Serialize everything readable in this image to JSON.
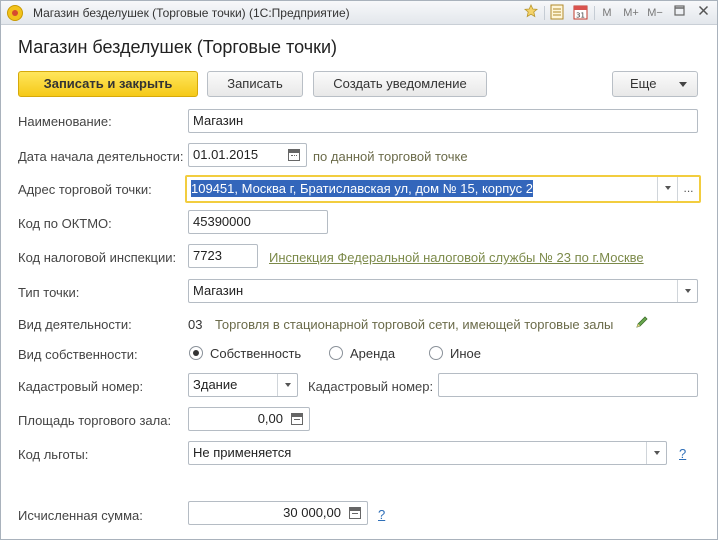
{
  "window": {
    "title": "Магазин безделушек (Торговые точки)  (1С:Предприятие)",
    "toolbar_icons": [
      "star-icon",
      "notes-icon",
      "calendar-icon"
    ],
    "memory_buttons": [
      "M",
      "M+",
      "M−"
    ]
  },
  "form": {
    "heading": "Магазин безделушек (Торговые точки)"
  },
  "toolbar": {
    "save_close_label": "Записать и закрыть",
    "save_label": "Записать",
    "notify_label": "Создать уведомление",
    "more_label": "Еще"
  },
  "fields": {
    "name": {
      "label": "Наименование:",
      "value": "Магазин"
    },
    "start_date": {
      "label": "Дата начала деятельности:",
      "value": "01.01.2015",
      "note": "по данной торговой точке"
    },
    "address": {
      "label": "Адрес торговой точки:",
      "value": "109451, Москва г, Братиславская ул, дом № 15, корпус 2",
      "more": "..."
    },
    "oktmo": {
      "label": "Код по ОКТМО:",
      "value": "45390000"
    },
    "tax_office": {
      "label": "Код налоговой инспекции:",
      "value": "7723",
      "link": "Инспекция Федеральной налоговой службы № 23 по г.Москве"
    },
    "point_type": {
      "label": "Тип точки:",
      "value": "Магазин"
    },
    "activity": {
      "label": "Вид деятельности:",
      "code": "03",
      "description": "Торговля в стационарной торговой сети, имеющей торговые залы"
    },
    "ownership": {
      "label": "Вид собственности:",
      "options": [
        "Собственность",
        "Аренда",
        "Иное"
      ],
      "selected": "Собственность"
    },
    "cadastral": {
      "label": "Кадастровый номер:",
      "type_value": "Здание",
      "number_label": "Кадастровый номер:",
      "number_value": ""
    },
    "hall_area": {
      "label": "Площадь торгового зала:",
      "value": "0,00"
    },
    "benefit_code": {
      "label": "Код льготы:",
      "value": "Не применяется",
      "help": "?"
    },
    "calculated_sum": {
      "label": "Исчисленная сумма:",
      "value": "30 000,00",
      "help": "?"
    }
  },
  "colors": {
    "primary_button": "#f5c918",
    "focus_border": "#f2cd3f",
    "selection": "#3366bb",
    "link": "#7c8a4a",
    "help": "#2f6fb8"
  }
}
